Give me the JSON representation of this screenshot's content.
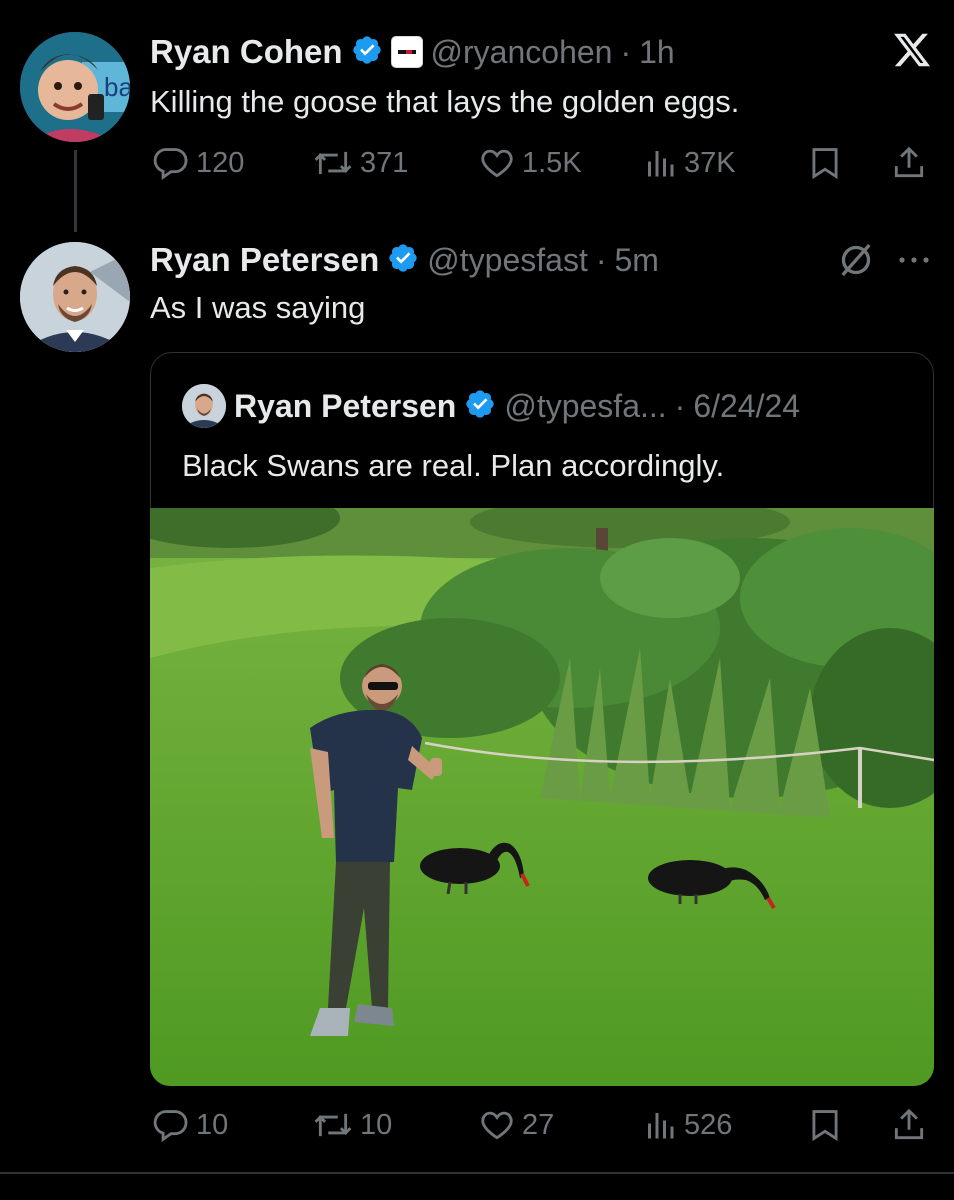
{
  "post1": {
    "author": "Ryan Cohen",
    "handle": "@ryancohen",
    "time": "1h",
    "text": "Killing the goose that lays the golden eggs.",
    "avatar_badge_text": "ba",
    "stats": {
      "replies": "120",
      "reposts": "371",
      "likes": "1.5K",
      "views": "37K"
    }
  },
  "post2": {
    "author": "Ryan Petersen",
    "handle": "@typesfast",
    "time": "5m",
    "text": "As I was saying",
    "stats": {
      "replies": "10",
      "reposts": "10",
      "likes": "27",
      "views": "526"
    }
  },
  "quote": {
    "author": "Ryan Petersen",
    "handle": "@typesfa...",
    "date": "6/24/24",
    "text": "Black Swans are real. Plan accordingly."
  },
  "colors": {
    "background": "#000000",
    "text_primary": "#e7e9ea",
    "text_secondary": "#71767b",
    "verified_blue": "#1d9bf0",
    "border": "#2f3336",
    "grass": "#5ea12a"
  },
  "icons": [
    "reply-icon",
    "repost-icon",
    "like-icon",
    "views-icon",
    "bookmark-icon",
    "share-icon",
    "x-logo-icon",
    "more-icon",
    "grok-icon",
    "verified-badge-icon"
  ]
}
